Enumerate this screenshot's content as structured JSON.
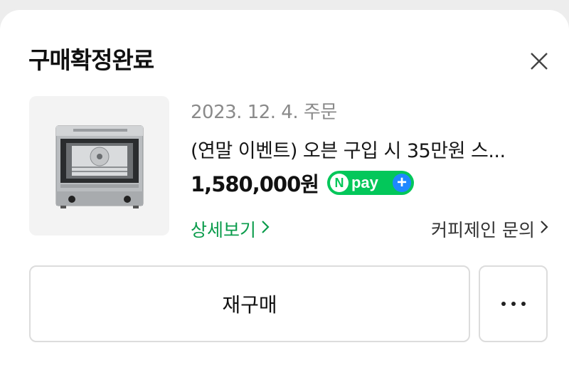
{
  "header": {
    "title": "구매확정완료",
    "close_icon": "close-icon"
  },
  "order": {
    "date_label": "2023. 12. 4. 주문",
    "product_name": "(연말 이벤트) 오븐 구입 시 35만원 스...",
    "price": "1,580,000원",
    "npay_badge": {
      "letter": "N",
      "text": "pay",
      "plus": "+",
      "icon": "npay-plus-badge"
    },
    "detail_link": "상세보기",
    "inquiry_link": "커피제인 문의"
  },
  "actions": {
    "rebuy_label": "재구매",
    "more_icon": "more-horizontal-icon"
  },
  "colors": {
    "npay_green": "#03c75a",
    "link_green": "#0b9c4c",
    "plus_blue": "#1e88ff"
  }
}
